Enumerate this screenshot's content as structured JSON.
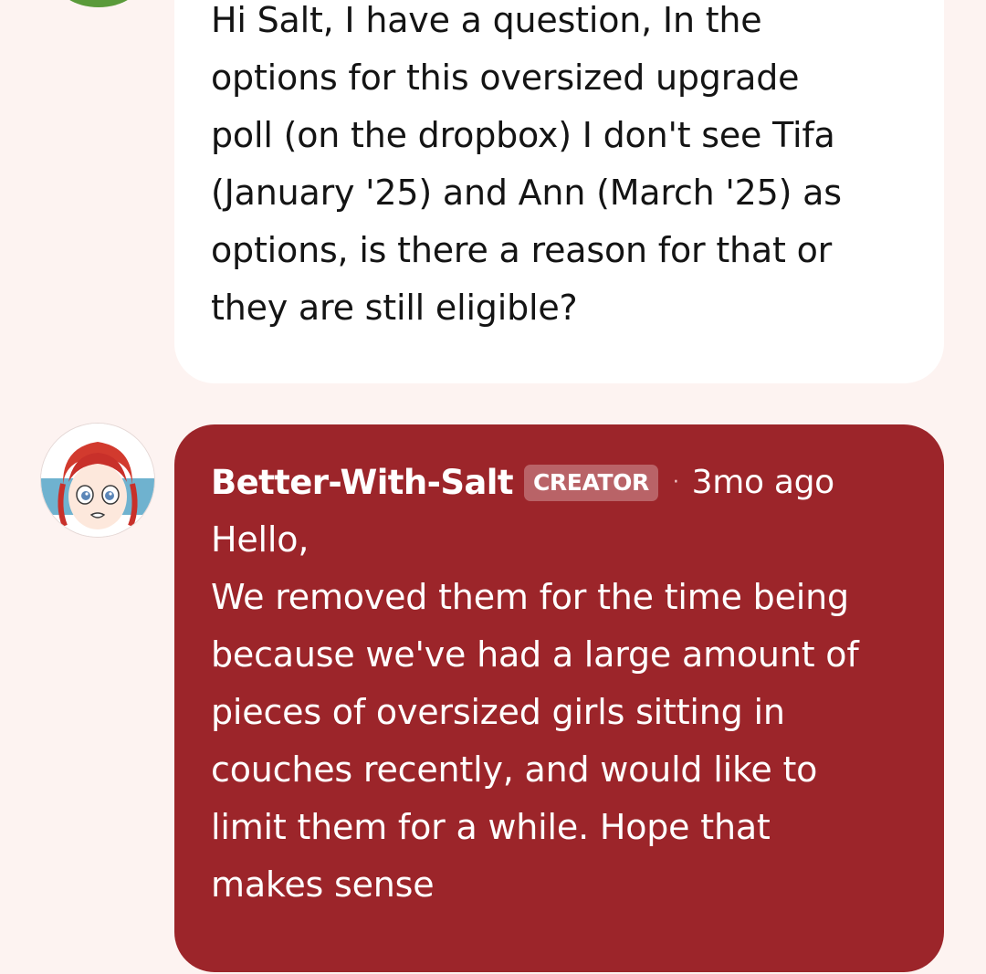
{
  "previous_comment": {
    "lines": [
      "Hi Salt, I have a question, In the",
      "options for this oversized upgrade",
      "poll (on the dropbox) I don't see Tifa",
      "(January '25) and Ann (March '25) as",
      "options, is there a reason for that or",
      "they are still eligible?"
    ]
  },
  "reply": {
    "author": "Better-With-Salt",
    "badge": "CREATOR",
    "separator": "·",
    "time": "3mo ago",
    "lines": [
      "Hello,",
      "We removed them for the time being",
      "because we've had a large amount of",
      "pieces of oversized girls sitting in",
      "couches recently, and would like to",
      "limit them for a while. Hope that",
      "makes sense"
    ]
  },
  "colors": {
    "background": "#fdf3f1",
    "reply_bubble": "#9c252a",
    "badge": "#b96367",
    "prev_avatar": "#5a9a3a"
  }
}
